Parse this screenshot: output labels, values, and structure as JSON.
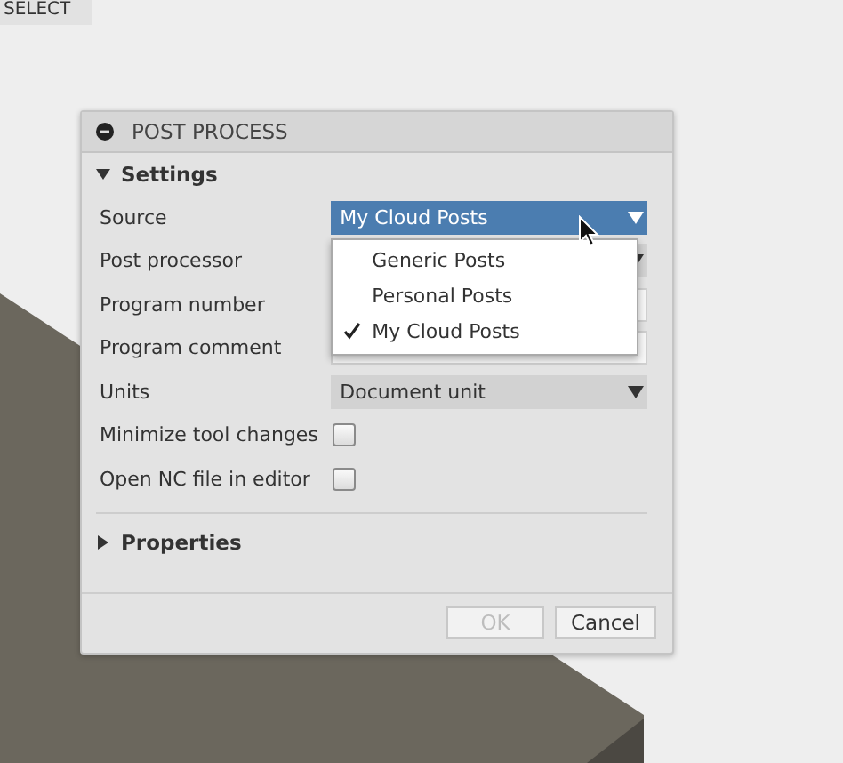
{
  "viewport": {
    "tab": "SELECT"
  },
  "dialog": {
    "title": "POST PROCESS",
    "sections": [
      {
        "title": "Settings",
        "expanded": true,
        "rows": [
          {
            "kind": "select",
            "label": "Source",
            "value": "My Cloud Posts",
            "open": true,
            "options": [
              {
                "label": "Generic Posts",
                "checked": false
              },
              {
                "label": "Personal Posts",
                "checked": false
              },
              {
                "label": "My Cloud Posts",
                "checked": true
              }
            ]
          },
          {
            "kind": "select",
            "label": "Post processor"
          },
          {
            "kind": "text",
            "label": "Program number"
          },
          {
            "kind": "text",
            "label": "Program comment"
          },
          {
            "kind": "select",
            "label": "Units",
            "value": "Document unit",
            "open": false
          },
          {
            "kind": "checkbox",
            "label": "Minimize tool changes",
            "checked": false
          },
          {
            "kind": "checkbox",
            "label": "Open NC file in editor",
            "checked": false
          }
        ]
      },
      {
        "title": "Properties",
        "expanded": false
      }
    ],
    "buttons": [
      {
        "label": "OK",
        "disabled": true
      },
      {
        "label": "Cancel",
        "disabled": false
      }
    ]
  }
}
